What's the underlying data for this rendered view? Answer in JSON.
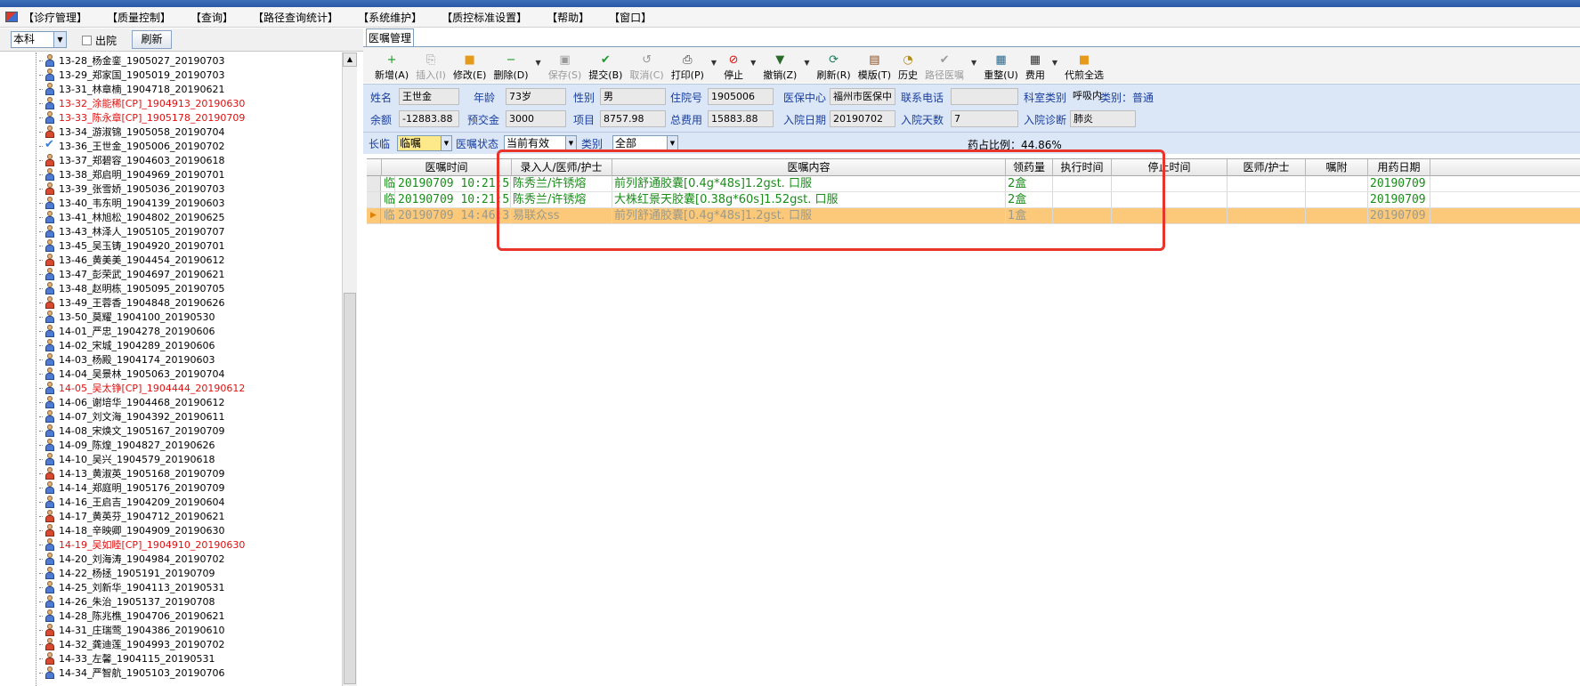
{
  "menu": [
    "【诊疗管理】",
    "【质量控制】",
    "【查询】",
    "【路径查询统计】",
    "【系统维护】",
    "【质控标准设置】",
    "【帮助】",
    "【窗口】"
  ],
  "left": {
    "dept": "本科",
    "discharge_label": "出院",
    "refresh_label": "刷新",
    "patients": [
      {
        "label": "13-28_杨金銮_1905027_20190703",
        "icon": "male",
        "red": false
      },
      {
        "label": "13-29_郑家国_1905019_20190703",
        "icon": "male",
        "red": false
      },
      {
        "label": "13-31_林章楠_1904718_20190621",
        "icon": "male",
        "red": false
      },
      {
        "label": "13-32_涂能稀[CP]_1904913_20190630",
        "icon": "male",
        "red": true
      },
      {
        "label": "13-33_陈永章[CP]_1905178_20190709",
        "icon": "male",
        "red": true
      },
      {
        "label": "13-34_游淑锦_1905058_20190704",
        "icon": "female",
        "red": false
      },
      {
        "label": "13-36_王世金_1905006_20190702",
        "icon": "checked",
        "red": false
      },
      {
        "label": "13-37_郑碧容_1904603_20190618",
        "icon": "female",
        "red": false
      },
      {
        "label": "13-38_郑启明_1904969_20190701",
        "icon": "male",
        "red": false
      },
      {
        "label": "13-39_张雪娇_1905036_20190703",
        "icon": "female",
        "red": false
      },
      {
        "label": "13-40_韦东明_1904139_20190603",
        "icon": "male",
        "red": false
      },
      {
        "label": "13-41_林旭松_1904802_20190625",
        "icon": "male",
        "red": false
      },
      {
        "label": "13-43_林泽人_1905105_20190707",
        "icon": "male",
        "red": false
      },
      {
        "label": "13-45_吴玉铸_1904920_20190701",
        "icon": "male",
        "red": false
      },
      {
        "label": "13-46_黄美美_1904454_20190612",
        "icon": "female",
        "red": false
      },
      {
        "label": "13-47_彭荣武_1904697_20190621",
        "icon": "male",
        "red": false
      },
      {
        "label": "13-48_赵明栋_1905095_20190705",
        "icon": "male",
        "red": false
      },
      {
        "label": "13-49_王蓉香_1904848_20190626",
        "icon": "female",
        "red": false
      },
      {
        "label": "13-50_莫耀_1904100_20190530",
        "icon": "male",
        "red": false
      },
      {
        "label": "14-01_严忠_1904278_20190606",
        "icon": "male",
        "red": false
      },
      {
        "label": "14-02_宋城_1904289_20190606",
        "icon": "male",
        "red": false
      },
      {
        "label": "14-03_杨殿_1904174_20190603",
        "icon": "male",
        "red": false
      },
      {
        "label": "14-04_吴景林_1905063_20190704",
        "icon": "male",
        "red": false
      },
      {
        "label": "14-05_吴太铮[CP]_1904444_20190612",
        "icon": "male",
        "red": true
      },
      {
        "label": "14-06_谢培华_1904468_20190612",
        "icon": "male",
        "red": false
      },
      {
        "label": "14-07_刘文海_1904392_20190611",
        "icon": "male",
        "red": false
      },
      {
        "label": "14-08_宋焕文_1905167_20190709",
        "icon": "male",
        "red": false
      },
      {
        "label": "14-09_陈煌_1904827_20190626",
        "icon": "male",
        "red": false
      },
      {
        "label": "14-10_吴兴_1904579_20190618",
        "icon": "male",
        "red": false
      },
      {
        "label": "14-13_黄淑英_1905168_20190709",
        "icon": "female",
        "red": false
      },
      {
        "label": "14-14_郑庭明_1905176_20190709",
        "icon": "male",
        "red": false
      },
      {
        "label": "14-16_王启吉_1904209_20190604",
        "icon": "male",
        "red": false
      },
      {
        "label": "14-17_黄英芬_1904712_20190621",
        "icon": "female",
        "red": false
      },
      {
        "label": "14-18_辛映卿_1904909_20190630",
        "icon": "female",
        "red": false
      },
      {
        "label": "14-19_吴如睦[CP]_1904910_20190630",
        "icon": "male",
        "red": true
      },
      {
        "label": "14-20_刘海涛_1904984_20190702",
        "icon": "male",
        "red": false
      },
      {
        "label": "14-22_杨拯_1905191_20190709",
        "icon": "male",
        "red": false
      },
      {
        "label": "14-25_刘新华_1904113_20190531",
        "icon": "male",
        "red": false
      },
      {
        "label": "14-26_朱治_1905137_20190708",
        "icon": "male",
        "red": false
      },
      {
        "label": "14-28_陈兆樵_1904706_20190621",
        "icon": "male",
        "red": false
      },
      {
        "label": "14-31_庄瑞莺_1904386_20190610",
        "icon": "female",
        "red": false
      },
      {
        "label": "14-32_龚迪莲_1904993_20190702",
        "icon": "female",
        "red": false
      },
      {
        "label": "14-33_左馨_1904115_20190531",
        "icon": "female",
        "red": false
      },
      {
        "label": "14-34_严智航_1905103_20190706",
        "icon": "male",
        "red": false
      }
    ]
  },
  "tab_label": "医嘱管理",
  "toolbar": [
    {
      "label": "新增(A)",
      "icon": "plus-icon",
      "glyph": "+",
      "color": "#1a9a2a",
      "disabled": false
    },
    {
      "label": "插入(I)",
      "icon": "insert-icon",
      "glyph": "⎘",
      "color": "#9a9a9a",
      "disabled": true
    },
    {
      "label": "修改(E)",
      "icon": "edit-icon",
      "glyph": "■",
      "color": "#e69a1a",
      "disabled": false
    },
    {
      "label": "删除(D)",
      "icon": "delete-icon",
      "glyph": "−",
      "color": "#1a9a2a",
      "disabled": false,
      "drop": true
    },
    {
      "label": "保存(S)",
      "icon": "save-icon",
      "glyph": "▣",
      "color": "#9a9a9a",
      "disabled": true
    },
    {
      "label": "提交(B)",
      "icon": "submit-icon",
      "glyph": "✔",
      "color": "#1a9a2a",
      "disabled": false
    },
    {
      "label": "取消(C)",
      "icon": "cancel-icon",
      "glyph": "↺",
      "color": "#9a9a9a",
      "disabled": true
    },
    {
      "label": "打印(P)",
      "icon": "print-icon",
      "glyph": "⎙",
      "color": "#333333",
      "disabled": false,
      "drop": true
    },
    {
      "label": "停止",
      "icon": "stop-icon",
      "glyph": "⊘",
      "color": "#e01010",
      "disabled": false,
      "drop": true
    },
    {
      "label": "撤销(Z)",
      "icon": "undo-icon",
      "glyph": "▼",
      "color": "#2a6a2a",
      "disabled": false,
      "drop": true
    },
    {
      "label": "刷新(R)",
      "icon": "refresh-icon",
      "glyph": "⟳",
      "color": "#1a7a5a",
      "disabled": false
    },
    {
      "label": "模版(T)",
      "icon": "template-icon",
      "glyph": "▤",
      "color": "#8a4a1a",
      "disabled": false
    },
    {
      "label": "历史",
      "icon": "history-icon",
      "glyph": "◔",
      "color": "#b08a1a",
      "disabled": false
    },
    {
      "label": "路径医嘱",
      "icon": "path-order-icon",
      "glyph": "✔",
      "color": "#9a9a9a",
      "disabled": true,
      "drop": true
    },
    {
      "label": "重整(U)",
      "icon": "reorganize-icon",
      "glyph": "▦",
      "color": "#1a6a9a",
      "disabled": false
    },
    {
      "label": "费用",
      "icon": "fee-icon",
      "glyph": "▦",
      "color": "#333333",
      "disabled": false,
      "drop": true
    },
    {
      "label": "代煎全选",
      "icon": "decoct-icon",
      "glyph": "■",
      "color": "#e69a1a",
      "disabled": false
    }
  ],
  "info": {
    "name_label": "姓名",
    "name": "王世金",
    "age_label": "年龄",
    "age": "73岁",
    "sex_label": "性别",
    "sex": "男",
    "inpatient_no_label": "住院号",
    "inpatient_no": "1905006",
    "insurance_label": "医保中心",
    "insurance": "福州市医保中",
    "phone_label": "联系电话",
    "phone": "",
    "dept_type_label": "科室类别",
    "dept_type": "呼吸内",
    "category_text": "类别：普通",
    "balance_label": "余额",
    "balance": "-12883.88",
    "prepay_label": "预交金",
    "prepay": "3000",
    "items_label": "项目",
    "items": "8757.98",
    "total_label": "总费用",
    "total": "15883.88",
    "admit_date_label": "入院日期",
    "admit_date": "20190702",
    "days_label": "入院天数",
    "days": "7",
    "diagnosis_label": "入院诊断",
    "diagnosis": "肺炎"
  },
  "filter": {
    "type_label": "长临",
    "type_value": "临嘱",
    "status_label": "医嘱状态",
    "status_value": "当前有效",
    "class_label": "类别",
    "class_value": "全部",
    "ratio_text": "药占比例：44.86%"
  },
  "grid": {
    "columns": [
      "医嘱时间",
      "录入人/医师/护士",
      "医嘱内容",
      "领药量",
      "执行时间",
      "停止时间",
      "医师/护士",
      "嘱附",
      "用药日期"
    ],
    "rows": [
      {
        "kind": "临",
        "time": "20190709 10:21:59",
        "person": "陈秀兰/许锈熔",
        "content": "前列舒通胶囊[0.4g*48s]1.2gst. 口服",
        "qty": "2盒",
        "exec": "",
        "stop": "",
        "doc": "",
        "note": "",
        "date": "20190709",
        "selected": false
      },
      {
        "kind": "临",
        "time": "20190709 10:21:59",
        "person": "陈秀兰/许锈熔",
        "content": "大株红景天胶囊[0.38g*60s]1.52gst. 口服",
        "qty": "2盒",
        "exec": "",
        "stop": "",
        "doc": "",
        "note": "",
        "date": "20190709",
        "selected": false
      },
      {
        "kind": "临",
        "time": "20190709 14:46:36",
        "person": "易联众ss",
        "content": "前列舒通胶囊[0.4g*48s]1.2gst. 口服",
        "qty": "1盒",
        "exec": "",
        "stop": "",
        "doc": "",
        "note": "",
        "date": "20190709",
        "selected": true
      }
    ]
  },
  "colors": {
    "order_text": "#1a8c1a",
    "selected_row": "#fcc97a",
    "highlight_box": "#e8342a"
  }
}
